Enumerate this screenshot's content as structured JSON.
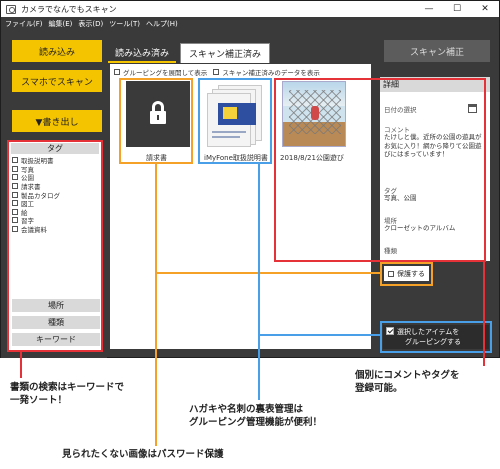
{
  "window": {
    "title": "カメラでなんでもスキャン",
    "controls": {
      "minimize": "—",
      "maximize": "☐",
      "close": "✕"
    }
  },
  "menu": [
    "ファイル(F)",
    "編集(E)",
    "表示(D)",
    "ツール(T)",
    "ヘルプ(H)"
  ],
  "sidebar": {
    "import_button": "読み込み",
    "phone_scan_button": "スマホでスキャン",
    "export_button": "▼書き出し",
    "tag_header": "タグ",
    "tags": [
      "取扱説明書",
      "写真",
      "公園",
      "請求書",
      "製品カタログ",
      "図工",
      "絵",
      "習字",
      "会議資料"
    ],
    "place_label": "場所",
    "type_label": "種類",
    "keyword_label": "キーワード"
  },
  "tabs": {
    "imported": "読み込み済み",
    "scan_fixed": "スキャン補正済み"
  },
  "options": {
    "expand_grouping": "グルーピングを展開して表示",
    "fixed_only": "スキャン補正済みのデータを表示"
  },
  "thumbnails": [
    {
      "caption": "請求書"
    },
    {
      "caption": "iMyFone取扱説明書"
    },
    {
      "caption": "2018/8/21公園遊び"
    }
  ],
  "scan_fix_button": "スキャン補正",
  "detail": {
    "header": "詳細",
    "date_label": "日付の選択",
    "comment_label": "コメント",
    "comment_text": "たけしと僕。近所の公園の遊具がお気に入り！網から降りて公園遊びにはまっています！",
    "tag_label": "タグ",
    "tag_value": "写真、公園",
    "place_label": "場所",
    "place_value": "クローゼットのアルバム",
    "type_label": "種類"
  },
  "protect_label": "保護する",
  "group_button": {
    "line1": "選択したアイテムを",
    "line2": "グルーピングする"
  },
  "callouts": {
    "search": {
      "line1": "書類の検索はキーワードで",
      "line2": "一発ソート！"
    },
    "password": "見られたくない画像はパスワード保護",
    "grouping": {
      "line1": "ハガキや名刺の裏表管理は",
      "line2": "グルーピング管理機能が便利！"
    },
    "individual": {
      "line1": "個別にコメントやタグを",
      "line2": "登録可能。"
    }
  },
  "colors": {
    "accent_yellow": "#f5c400",
    "red": "#e53238",
    "orange": "#f5a128",
    "blue": "#4aa0e8",
    "dark_bg": "#3a3a3a"
  }
}
